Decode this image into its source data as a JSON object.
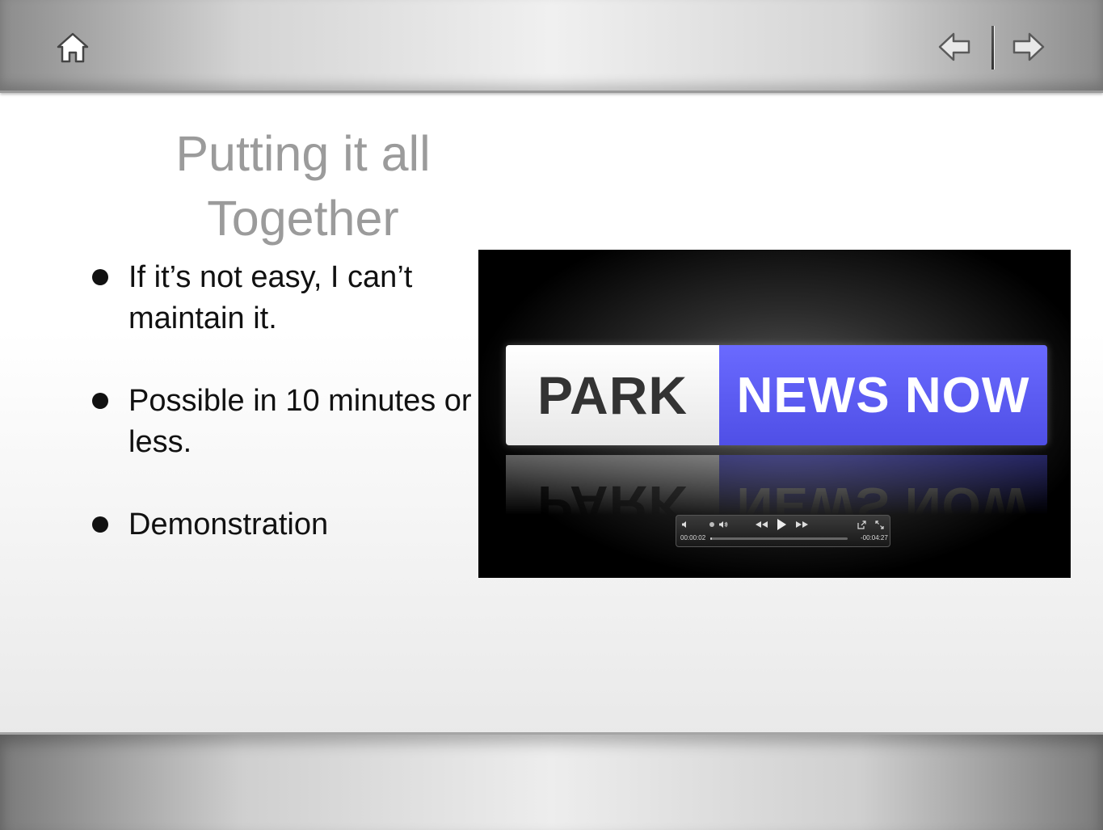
{
  "slide": {
    "title": "Putting it all Together",
    "bullets": [
      "If it’s not easy, I can’t maintain it.",
      "Possible in 10 minutes or less.",
      "Demonstration"
    ]
  },
  "navigation": {
    "home_icon": "home-icon",
    "back_icon": "arrow-left-icon",
    "forward_icon": "arrow-right-icon"
  },
  "video": {
    "logo_left": "PARK",
    "logo_right": "NEWS NOW",
    "logo_left_color": "#333333",
    "logo_right_bg": "#5555ee",
    "elapsed": "00:00:02",
    "remaining": "-00:04:27",
    "progress": 0.01,
    "icons": [
      "volume-icon",
      "rewind-icon",
      "play-icon",
      "fast-forward-icon",
      "share-icon",
      "fullscreen-icon"
    ]
  }
}
